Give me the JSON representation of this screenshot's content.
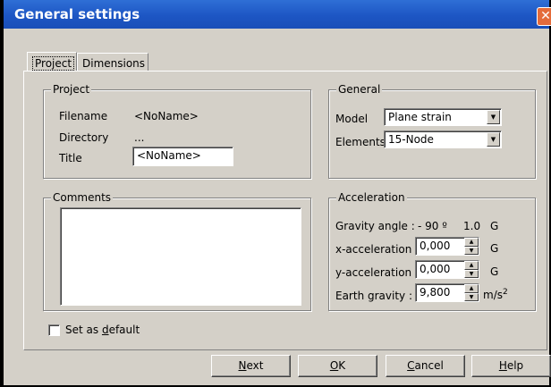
{
  "window": {
    "title": "General settings",
    "close_glyph": "✕"
  },
  "tabs": [
    {
      "label": "Project"
    },
    {
      "label": "Dimensions"
    }
  ],
  "project": {
    "group_label": "Project",
    "filename_label": "Filename",
    "filename_value": "<NoName>",
    "directory_label": "Directory",
    "directory_value": "...",
    "title_label": "Title",
    "title_value": "<NoName>"
  },
  "general": {
    "group_label": "General",
    "model_label": "Model",
    "model_value": "Plane strain",
    "elements_label": "Elements",
    "elements_value": "15-Node"
  },
  "comments": {
    "group_label": "Comments",
    "value": ""
  },
  "acceleration": {
    "group_label": "Acceleration",
    "gravity_angle_label": "Gravity angle :",
    "gravity_angle_value": "- 90 º",
    "gravity_g_value": "1.0",
    "gravity_g_unit": "G",
    "x_label": "x-acceleration :",
    "x_value": "0,000",
    "x_unit": "G",
    "y_label": "y-acceleration :",
    "y_value": "0,000",
    "y_unit": "G",
    "earth_label": "Earth gravity :",
    "earth_value": "9,800",
    "earth_unit": "m/s",
    "earth_unit_sup": "2"
  },
  "default_checkbox": {
    "label_pre": "Set as ",
    "label_u": "d",
    "label_post": "efault",
    "checked": false
  },
  "buttons": {
    "next": {
      "u": "N",
      "rest": "ext"
    },
    "ok": {
      "u": "O",
      "rest": "K"
    },
    "cancel": {
      "u": "C",
      "rest": "ancel"
    },
    "help": {
      "u": "H",
      "rest": "elp"
    }
  }
}
